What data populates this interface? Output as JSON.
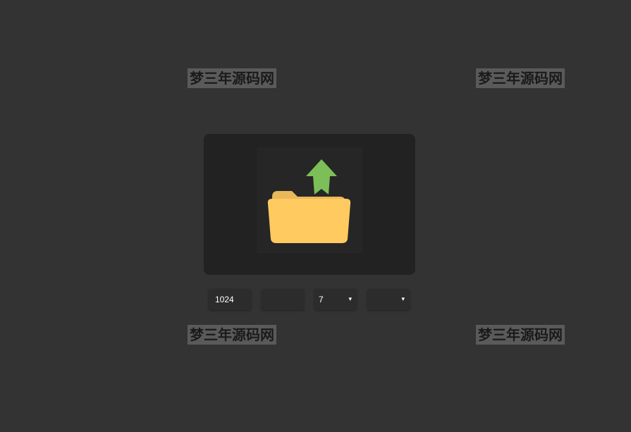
{
  "watermarks": {
    "top_left": "梦三年源码网",
    "top_right": "梦三年源码网",
    "bottom_left": "梦三年源码网",
    "bottom_right": "梦三年源码网"
  },
  "upload": {
    "icon": "folder-upload-icon",
    "folder_color": "#FFCA5F",
    "folder_back_color": "#E8B85A",
    "arrow_color": "#7CBF58"
  },
  "controls": {
    "width_value": "1024",
    "height_value": "",
    "select_one_value": "7",
    "select_one_caret": "▾",
    "select_two_value": "",
    "select_two_caret": "▾"
  },
  "colors": {
    "background": "#333333",
    "panel": "#222222"
  }
}
